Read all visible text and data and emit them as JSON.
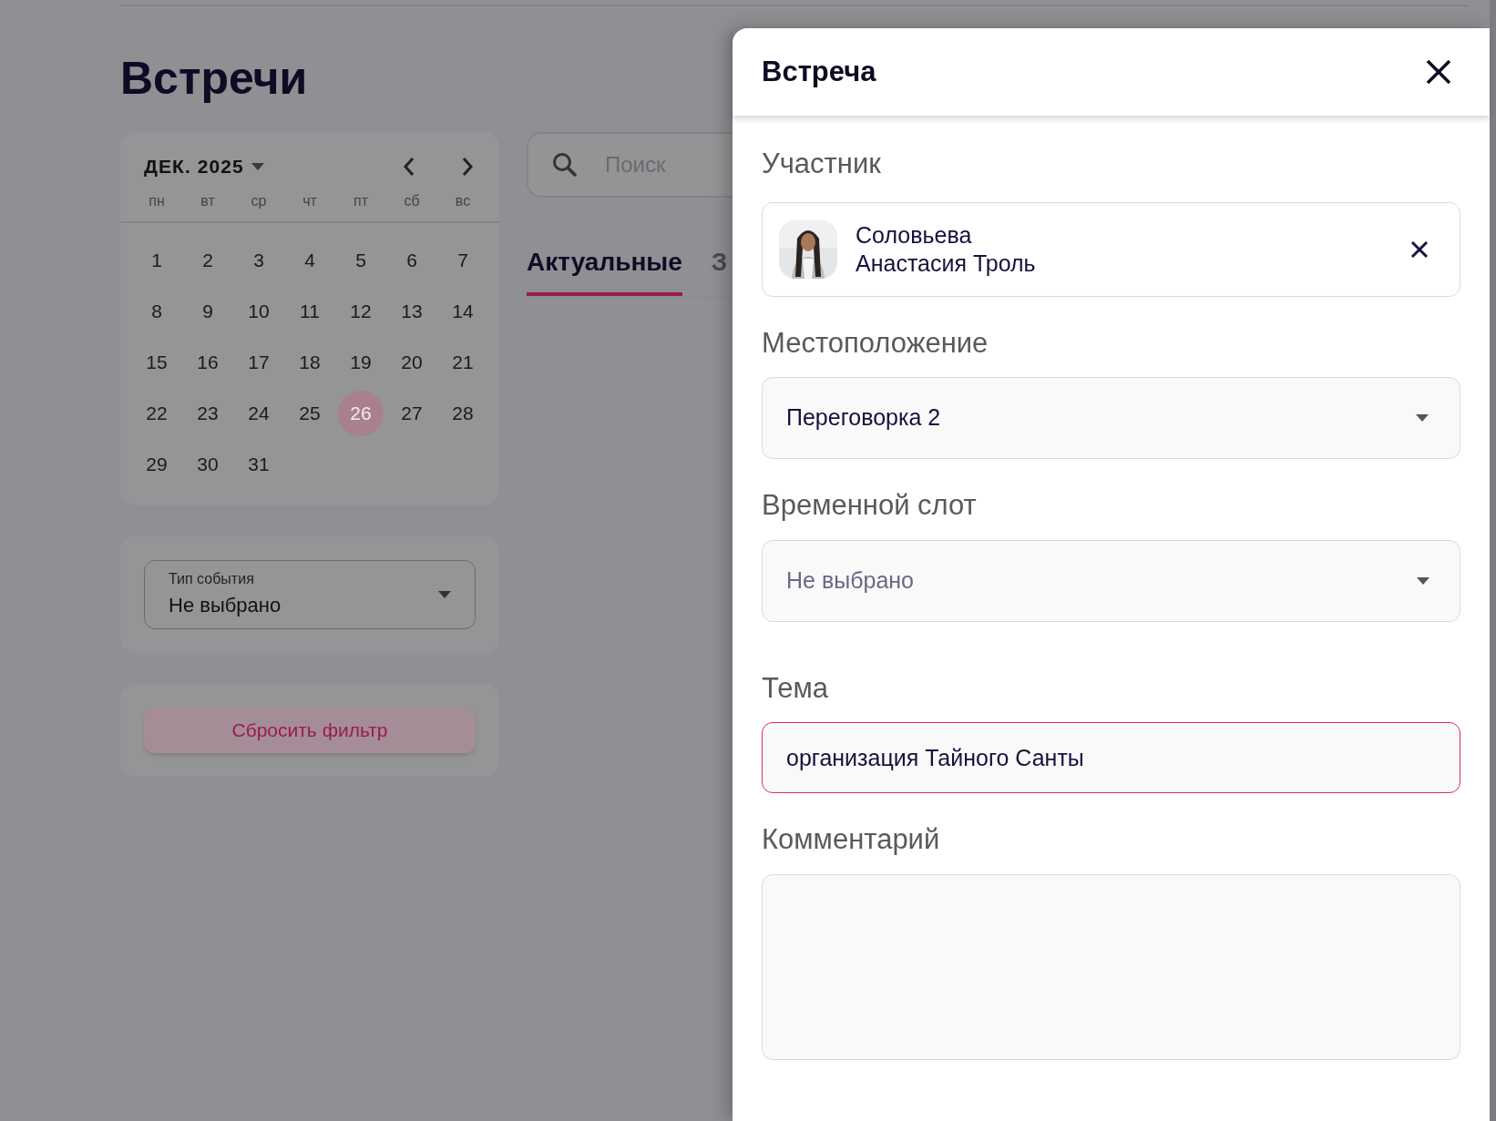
{
  "page": {
    "title": "Встречи",
    "calendar": {
      "month_label": "ДЕК. 2025",
      "weekdays": [
        "пн",
        "вт",
        "ср",
        "чт",
        "пт",
        "сб",
        "вс"
      ],
      "days": [
        {
          "label": "1",
          "selected": false
        },
        {
          "label": "2",
          "selected": false
        },
        {
          "label": "3",
          "selected": false
        },
        {
          "label": "4",
          "selected": false
        },
        {
          "label": "5",
          "selected": false
        },
        {
          "label": "6",
          "selected": false
        },
        {
          "label": "7",
          "selected": false
        },
        {
          "label": "8",
          "selected": false
        },
        {
          "label": "9",
          "selected": false
        },
        {
          "label": "10",
          "selected": false
        },
        {
          "label": "11",
          "selected": false
        },
        {
          "label": "12",
          "selected": false
        },
        {
          "label": "13",
          "selected": false
        },
        {
          "label": "14",
          "selected": false
        },
        {
          "label": "15",
          "selected": false
        },
        {
          "label": "16",
          "selected": false
        },
        {
          "label": "17",
          "selected": false
        },
        {
          "label": "18",
          "selected": false
        },
        {
          "label": "19",
          "selected": false
        },
        {
          "label": "20",
          "selected": false
        },
        {
          "label": "21",
          "selected": false
        },
        {
          "label": "22",
          "selected": false
        },
        {
          "label": "23",
          "selected": false
        },
        {
          "label": "24",
          "selected": false
        },
        {
          "label": "25",
          "selected": false
        },
        {
          "label": "26",
          "selected": true
        },
        {
          "label": "27",
          "selected": false
        },
        {
          "label": "28",
          "selected": false
        },
        {
          "label": "29",
          "selected": false
        },
        {
          "label": "30",
          "selected": false
        },
        {
          "label": "31",
          "selected": false
        }
      ]
    },
    "search": {
      "placeholder": "Поиск"
    },
    "tabs": [
      {
        "label": "Актуальные",
        "selected": true
      },
      {
        "label": "З",
        "selected": false
      }
    ],
    "event_type_filter": {
      "label": "Тип события",
      "value": "Не выбрано"
    },
    "reset_button": "Сбросить фильтр"
  },
  "drawer": {
    "title": "Встреча",
    "participant": {
      "label": "Участник",
      "name_lines": [
        "Соловьева",
        "Анастасия Троль"
      ]
    },
    "location": {
      "label": "Местоположение",
      "value": "Переговорка 2"
    },
    "time_slot": {
      "label": "Временной слот",
      "placeholder": "Не выбрано"
    },
    "topic": {
      "label": "Тема",
      "value": "организация Тайного Санты",
      "focused": true
    },
    "comment": {
      "label": "Комментарий"
    }
  }
}
